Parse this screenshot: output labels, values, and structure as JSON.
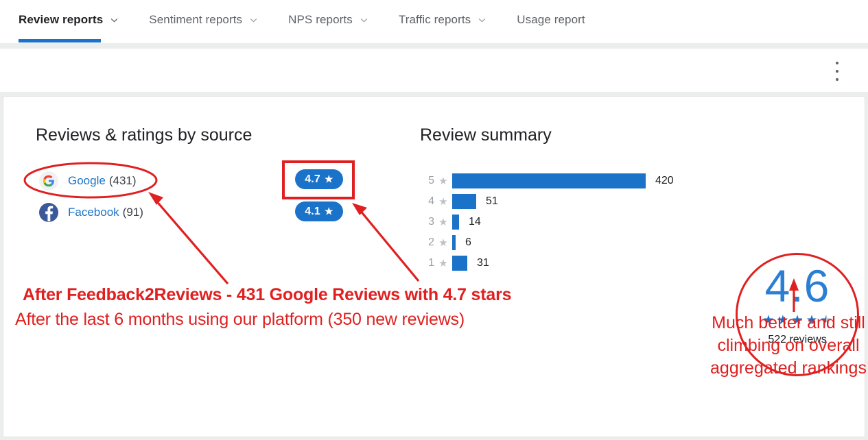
{
  "tabs": [
    {
      "label": "Review reports",
      "caret": true,
      "active": true,
      "icon": "chevron-down-icon"
    },
    {
      "label": "Sentiment reports",
      "caret": true,
      "active": false,
      "icon": "chevron-down-icon"
    },
    {
      "label": "NPS reports",
      "caret": true,
      "active": false,
      "icon": "chevron-down-icon"
    },
    {
      "label": "Traffic reports",
      "caret": true,
      "active": false,
      "icon": "chevron-down-icon"
    },
    {
      "label": "Usage report",
      "caret": false,
      "active": false,
      "icon": ""
    }
  ],
  "toolbar": {
    "menu_icon": "kebab-menu-icon"
  },
  "panels": {
    "sources_title": "Reviews & ratings by source",
    "summary_title": "Review summary"
  },
  "sources": [
    {
      "name": "Google",
      "count": "(431)",
      "rating": "4.7",
      "star": "★",
      "icon": "google-icon"
    },
    {
      "name": "Facebook",
      "count": "(91)",
      "rating": "4.1",
      "star": "★",
      "icon": "facebook-icon"
    }
  ],
  "aggregate": {
    "score": "4.6",
    "reviews_label": "522 reviews",
    "stars_full": 4,
    "stars_half": 1
  },
  "annotations": {
    "headline": "After Feedback2Reviews - 431 Google Reviews with 4.7 stars",
    "subline": "After the last 6 months using our platform (350 new reviews)",
    "right_note": "Much better and still climbing on overall aggregated rankings"
  },
  "colors": {
    "accent_blue": "#1a73c8",
    "annotation_red": "#e02020",
    "bar_blue": "#1a73c8",
    "star_gray": "#bdc1c6",
    "score_blue": "#2a7fd4",
    "facebook_blue": "#3b5998"
  },
  "chart_data": {
    "type": "bar",
    "orientation": "horizontal",
    "title": "Review summary",
    "xlabel": "",
    "ylabel": "",
    "categories": [
      "5 ★",
      "4 ★",
      "3 ★",
      "2 ★",
      "1 ★"
    ],
    "star_numbers": [
      "5",
      "4",
      "3",
      "2",
      "1"
    ],
    "values": [
      420,
      51,
      14,
      6,
      31
    ],
    "value_labels": [
      "420",
      "51",
      "14",
      "6",
      "31"
    ],
    "xlim": [
      0,
      420
    ],
    "grid": false,
    "legend": false,
    "bar_color": "#1a73c8",
    "total_reviews": 522
  }
}
